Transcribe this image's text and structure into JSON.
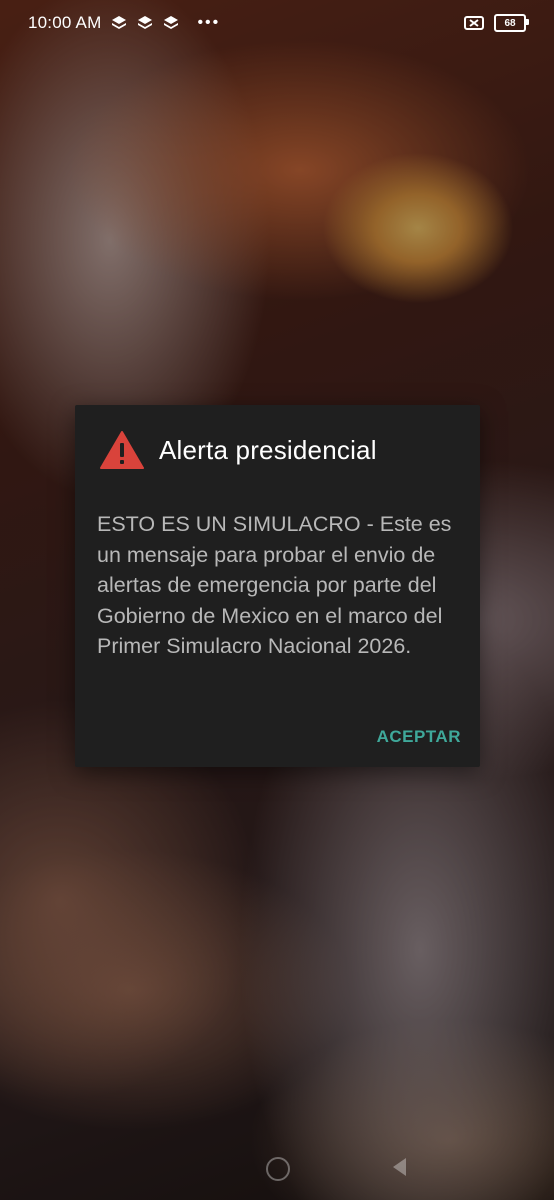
{
  "status_bar": {
    "time": "10:00 AM",
    "notification_icons": [
      "layers-icon",
      "layers-icon",
      "layers-icon"
    ],
    "overflow": "•••",
    "battery_level": "68",
    "sim_status": "no-sim-icon"
  },
  "alert": {
    "icon": "warning-triangle-icon",
    "title": "Alerta presidencial",
    "message": "ESTO ES UN SIMULACRO - Este es un mensaje para probar el envio de alertas de emergencia por parte del Gobierno de Mexico en el marco del Primer Simulacro Nacional 2026.",
    "accept_label": "ACEPTAR",
    "colors": {
      "icon": "#d9433b",
      "accent": "#3fa89a",
      "dialog_bg": "#1f1f1f"
    }
  },
  "nav": {
    "home": "home-circle-icon",
    "back": "back-triangle-icon"
  }
}
